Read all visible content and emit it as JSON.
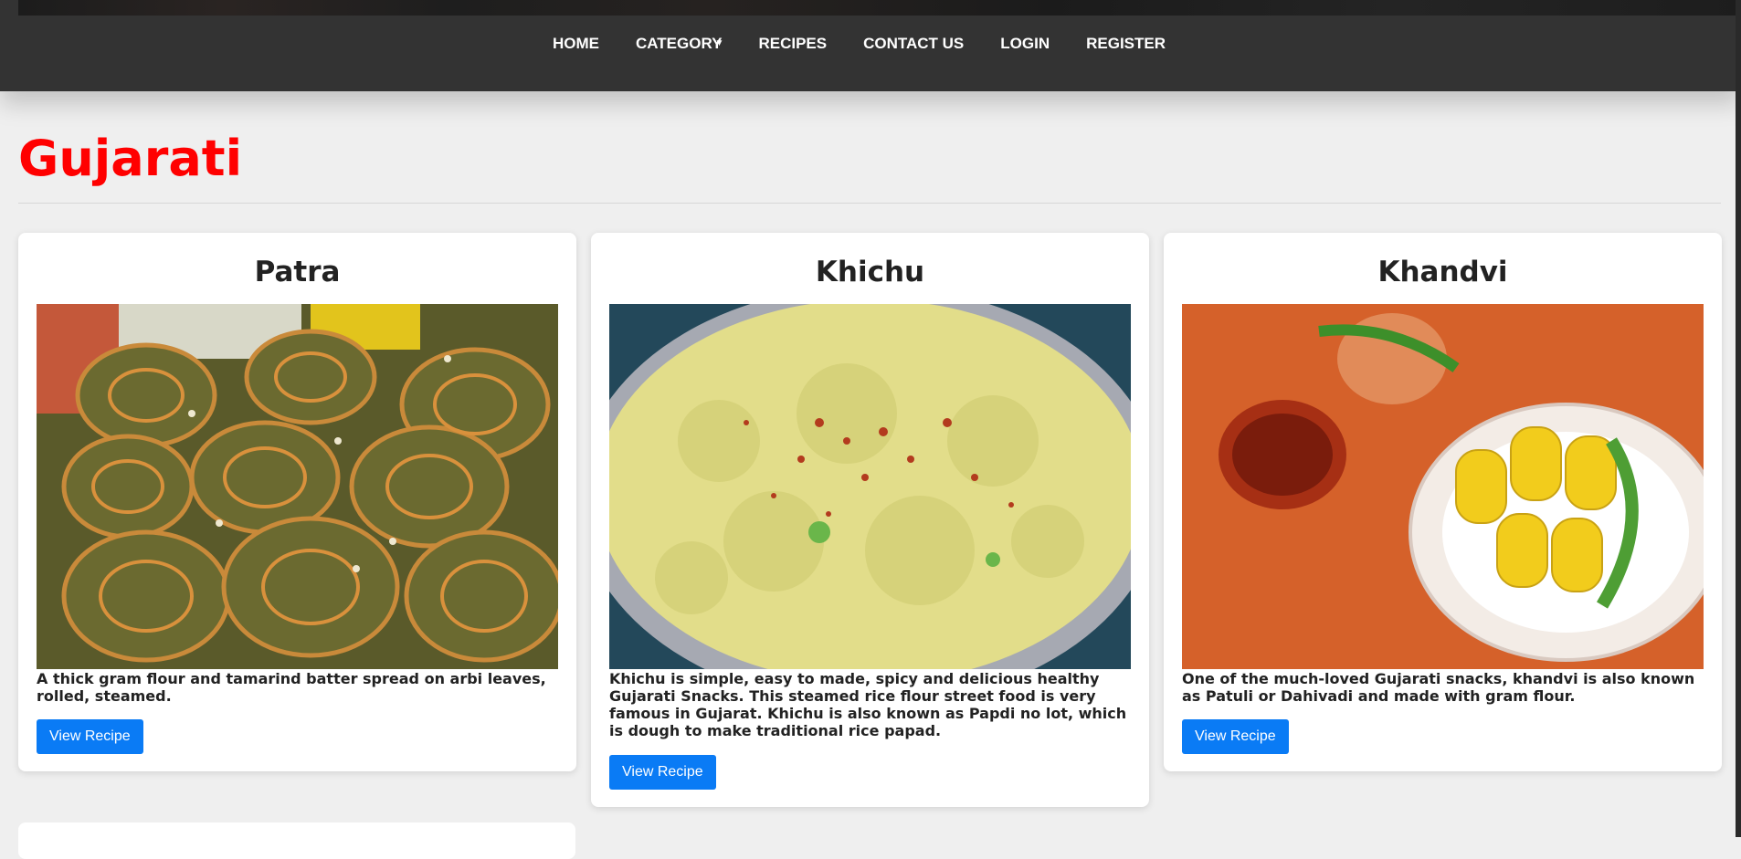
{
  "nav": {
    "items": [
      {
        "label": "HOME"
      },
      {
        "label": "CATEGORY"
      },
      {
        "label": "RECIPES"
      },
      {
        "label": "CONTACT US"
      },
      {
        "label": "LOGIN"
      },
      {
        "label": "REGISTER"
      }
    ]
  },
  "page": {
    "title": "Gujarati"
  },
  "recipes": [
    {
      "name": "Patra",
      "description": "A thick gram flour and tamarind batter spread on arbi leaves, rolled, steamed.",
      "button": "View Recipe"
    },
    {
      "name": "Khichu",
      "description": "Khichu is simple, easy to made, spicy and delicious healthy Gujarati Snacks. This steamed rice flour street food is very famous in Gujarat. Khichu is also known as Papdi no lot, which is dough to make traditional rice papad.",
      "button": "View Recipe"
    },
    {
      "name": "Khandvi",
      "description": "One of the much-loved Gujarati snacks, khandvi is also known as Patuli or Dahivadi and made with gram flour.",
      "button": "View Recipe"
    }
  ],
  "colors": {
    "nav_bg": "#333333",
    "title": "#ff0000",
    "button": "#0a7bf5",
    "page_bg": "#efefef"
  }
}
